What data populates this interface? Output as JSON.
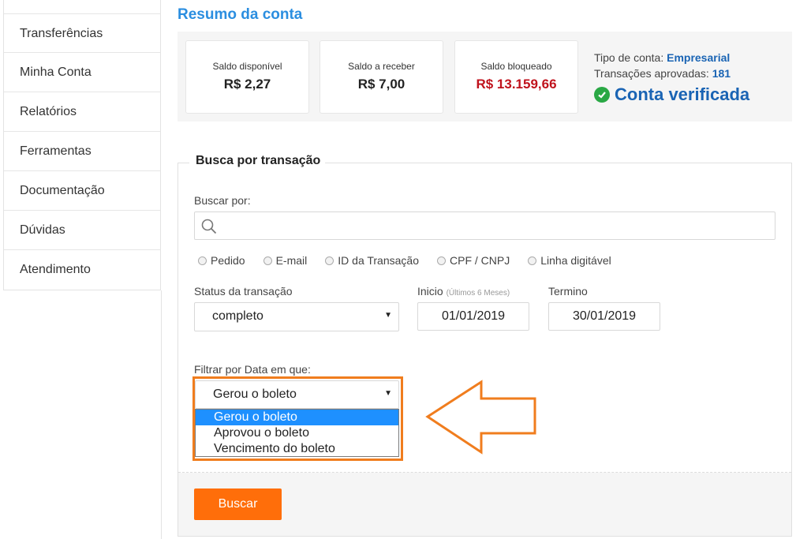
{
  "sidebar": {
    "items": [
      {
        "label": "Transferências"
      },
      {
        "label": "Minha Conta"
      },
      {
        "label": "Relatórios"
      },
      {
        "label": "Ferramentas"
      },
      {
        "label": "Documentação"
      },
      {
        "label": "Dúvidas"
      },
      {
        "label": "Atendimento"
      }
    ]
  },
  "summary": {
    "title": "Resumo da conta",
    "cards": [
      {
        "label": "Saldo disponível",
        "value": "R$ 2,27"
      },
      {
        "label": "Saldo a receber",
        "value": "R$ 7,00"
      },
      {
        "label": "Saldo bloqueado",
        "value": "R$ 13.159,66",
        "color": "#c0121c"
      }
    ],
    "account_type_label": "Tipo de conta:",
    "account_type_value": "Empresarial",
    "approved_label": "Transações aprovadas:",
    "approved_value": "181",
    "verified_text": "Conta verificada",
    "verified_icon": "check-circle-icon"
  },
  "search": {
    "legend": "Busca por transação",
    "buscar_por_label": "Buscar por:",
    "search_icon": "search-icon",
    "search_value": "",
    "radios": [
      "Pedido",
      "E-mail",
      "ID da Transação",
      "CPF / CNPJ",
      "Linha digitável"
    ],
    "status_label": "Status da transação",
    "status_value": "completo",
    "inicio_label": "Inicio",
    "inicio_hint": "(Últimos 6 Meses)",
    "inicio_value": "01/01/2019",
    "termino_label": "Termino",
    "termino_value": "30/01/2019",
    "filter_label": "Filtrar por Data em que:",
    "filter_value": "Gerou o boleto",
    "filter_options": [
      "Gerou o boleto",
      "Aprovou o boleto",
      "Vencimento do boleto"
    ],
    "submit_label": "Buscar"
  },
  "colors": {
    "accent_blue": "#2b8ee0",
    "highlight_orange": "#f07d1e",
    "button_orange": "#ff6e0a",
    "verified_green": "#2aa845"
  }
}
